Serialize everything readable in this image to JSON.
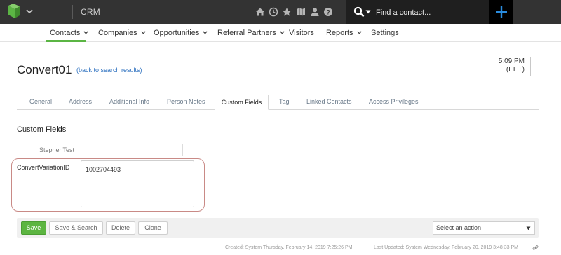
{
  "topbar": {
    "app_name": "CRM",
    "search_placeholder": "Find a contact...",
    "icons": [
      "home-icon",
      "clock-icon",
      "star-icon",
      "map-icon",
      "person-icon",
      "help-icon"
    ],
    "colors": {
      "bar": "#333333",
      "search_bg": "#1f1f1f",
      "add_bg": "#000000",
      "accent_blue": "#2a8cdf",
      "logo_green": "#5bb544"
    }
  },
  "nav": {
    "items": [
      {
        "label": "Contacts",
        "dropdown": true,
        "active": true
      },
      {
        "label": "Companies",
        "dropdown": true
      },
      {
        "label": "Opportunities",
        "dropdown": true
      },
      {
        "label": "Referral Partners",
        "dropdown": true
      },
      {
        "label": "Visitors",
        "dropdown": false
      },
      {
        "label": "Reports",
        "dropdown": true
      },
      {
        "label": "Settings",
        "dropdown": false
      }
    ],
    "active_color": "#5bb544"
  },
  "header": {
    "title": "Convert01",
    "back_link": "(back to search results)",
    "time": "5:09 PM",
    "timezone": "(EET)"
  },
  "tabs": {
    "items": [
      "General",
      "Address",
      "Additional Info",
      "Person Notes",
      "Custom Fields",
      "Tag",
      "Linked Contacts",
      "Access Privileges"
    ],
    "active": "Custom Fields"
  },
  "custom_fields": {
    "section_title": "Custom Fields",
    "field1": {
      "label": "StephenTest",
      "value": ""
    },
    "field2": {
      "label": "ConvertVariationID",
      "value": "1002704493"
    },
    "highlight_color": "#c98a86"
  },
  "actions": {
    "save": "Save",
    "save_search": "Save & Search",
    "delete": "Delete",
    "clone": "Clone",
    "select_action": "Select an action",
    "save_color": "#5cb541"
  },
  "footer": {
    "created": "Created:  System Thursday, February 14, 2019 7:25:26 PM",
    "updated": "Last Updated:  System Wednesday, February 20, 2019 3:48:33 PM"
  }
}
